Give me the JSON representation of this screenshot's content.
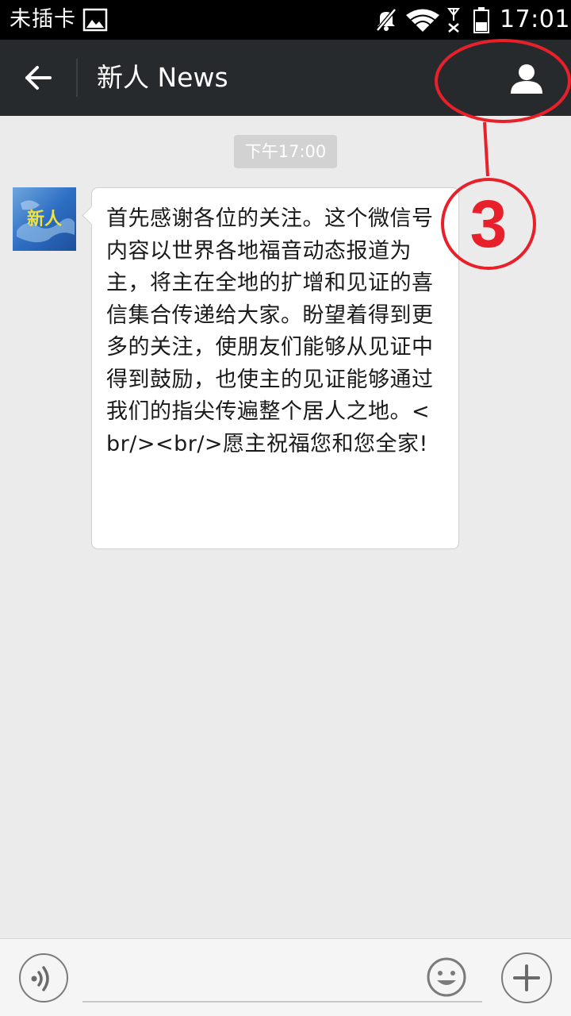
{
  "status_bar": {
    "carrier": "未插卡",
    "time": "17:01",
    "icons": [
      "gallery-icon",
      "mute-icon",
      "wifi-icon",
      "no-signal-icon",
      "battery-icon"
    ]
  },
  "header": {
    "title": "新人 News",
    "back_icon": "arrow-left-icon",
    "profile_icon": "person-icon"
  },
  "chat": {
    "timestamp": "下午17:00",
    "messages": [
      {
        "sender": "新人 News",
        "avatar_text": "新人",
        "text": "首先感谢各位的关注。这个微信号内容以世界各地福音动态报道为主，将主在全地的扩增和见证的喜信集合传递给大家。盼望着得到更多的关注，使朋友们能够从见证中得到鼓励，也使主的见证能够通过我们的指尖传遍整个居人之地。<br/><br/>愿主祝福您和您全家!"
      }
    ]
  },
  "annotation": {
    "number": "3",
    "color": "#e8202a"
  },
  "input_bar": {
    "input_value": "",
    "placeholder": "",
    "icons": [
      "voice-icon",
      "emoji-icon",
      "plus-icon"
    ]
  },
  "colors": {
    "status_bar_bg": "#000000",
    "title_bar_bg": "#262a2d",
    "chat_bg": "#ebebeb",
    "bubble_bg": "#ffffff",
    "timestamp_bg": "#d2d2d2",
    "annotation_red": "#e8202a"
  }
}
